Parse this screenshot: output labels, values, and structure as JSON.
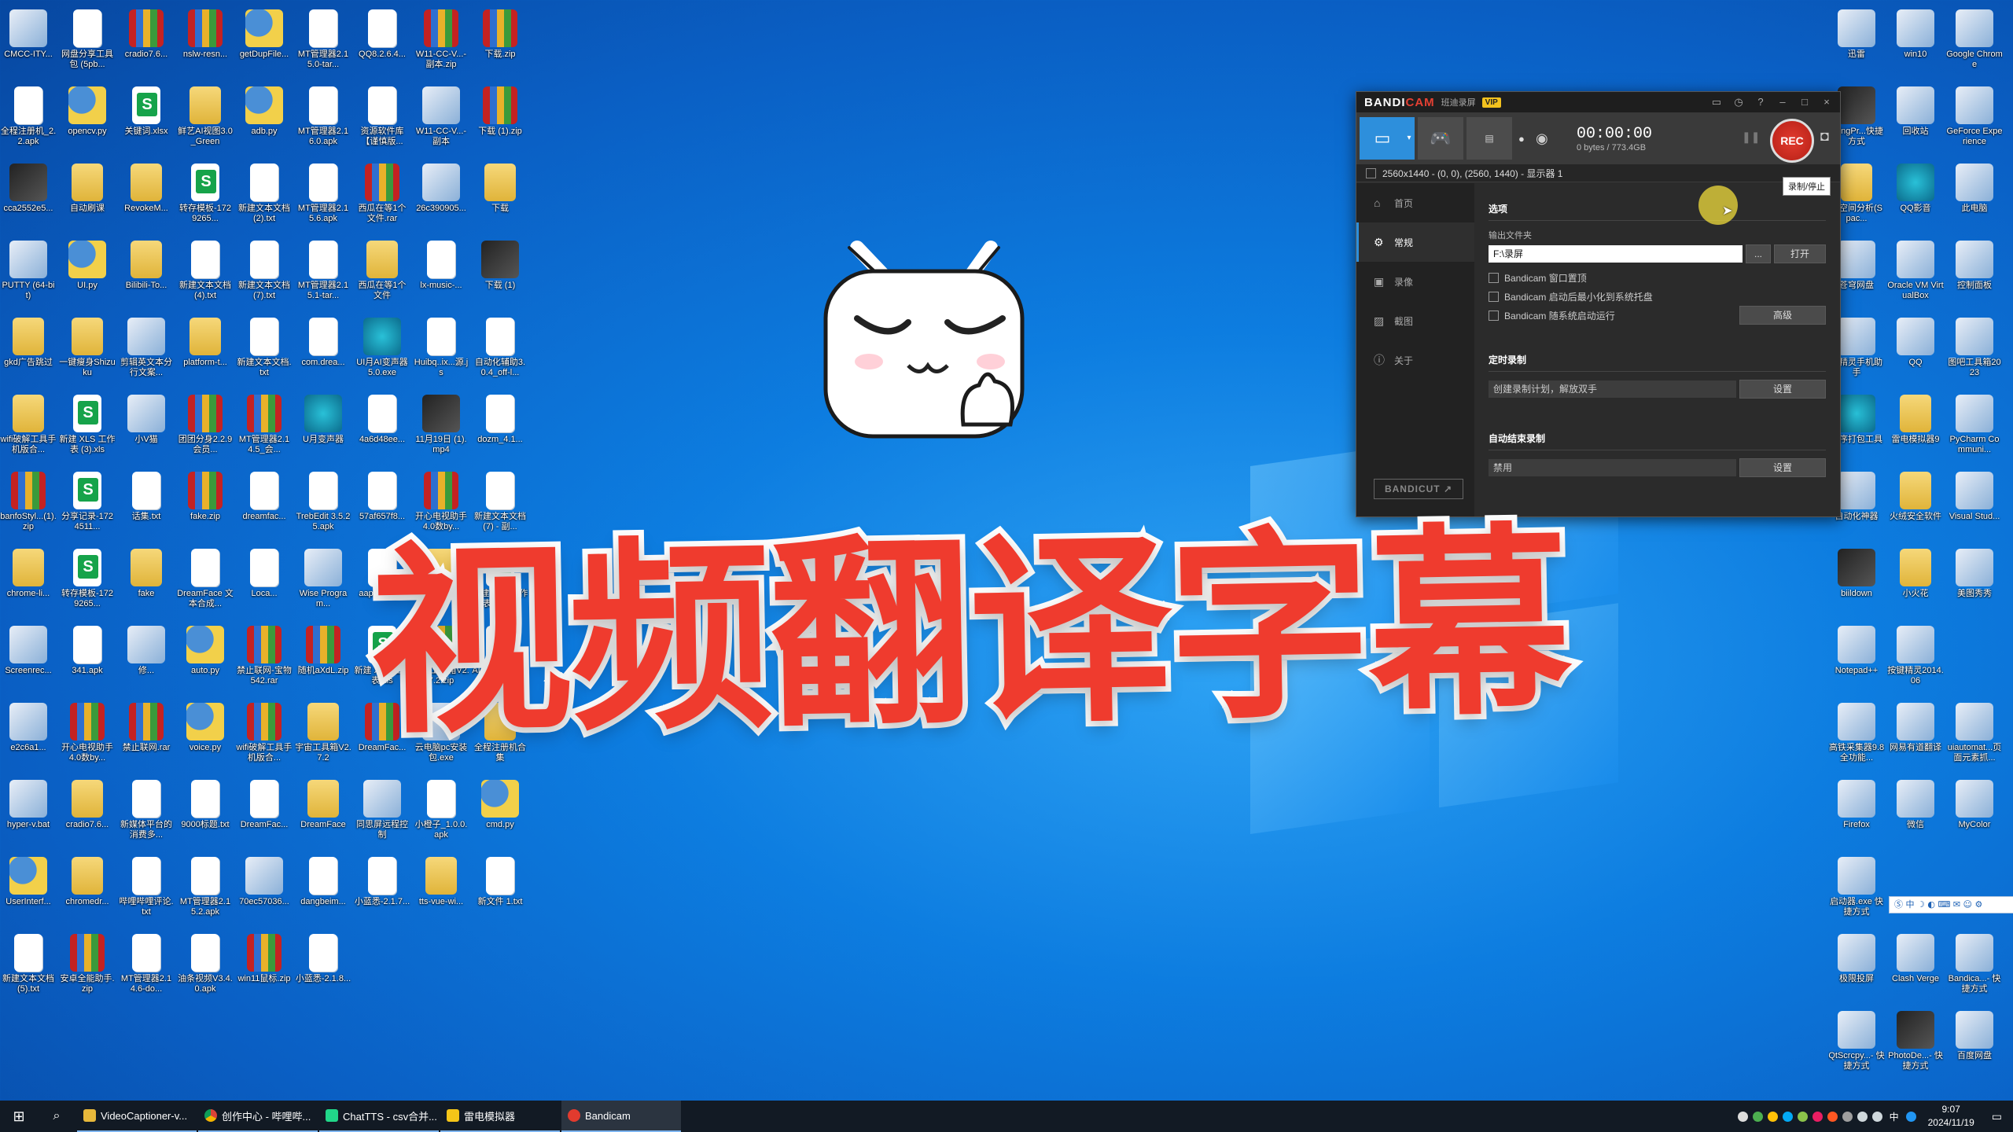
{
  "desktop": {
    "title_overlay": "视频翻译字幕",
    "icons_left": [
      {
        "label": "CMCC-ITY...",
        "type": "app"
      },
      {
        "label": "网盘分享工具包 (5pb...",
        "type": "doc"
      },
      {
        "label": "cradio7.6...",
        "type": "zip"
      },
      {
        "label": "nslw-resn...",
        "type": "zip"
      },
      {
        "label": "getDupFile...",
        "type": "py"
      },
      {
        "label": "MT管理器2.15.0-tar...",
        "type": "doc"
      },
      {
        "label": "QQ8.2.6.4...",
        "type": "doc"
      },
      {
        "label": "W11-CC-V...- 副本.zip",
        "type": "zip"
      },
      {
        "label": "下载.zip",
        "type": "zip"
      },
      {
        "label": "全程注册机_2.2.apk",
        "type": "doc"
      },
      {
        "label": "opencv.py",
        "type": "py"
      },
      {
        "label": "关键词.xlsx",
        "type": "xls"
      },
      {
        "label": "鲜艺AI视图3.0_Green",
        "type": "folder"
      },
      {
        "label": "adb.py",
        "type": "py"
      },
      {
        "label": "MT管理器2.16.0.apk",
        "type": "doc"
      },
      {
        "label": "资源软件库【谨慎版...",
        "type": "doc"
      },
      {
        "label": "W11-CC-V...- 副本",
        "type": "app"
      },
      {
        "label": "下载 (1).zip",
        "type": "zip"
      },
      {
        "label": "cca2552e5...",
        "type": "img"
      },
      {
        "label": "自动刷课",
        "type": "folder"
      },
      {
        "label": "RevokeM...",
        "type": "folder"
      },
      {
        "label": "转存模板-1729265...",
        "type": "xls"
      },
      {
        "label": "新建文本文档 (2).txt",
        "type": "doc"
      },
      {
        "label": "MT管理器2.15.6.apk",
        "type": "doc"
      },
      {
        "label": "西瓜在等1个文件.rar",
        "type": "zip"
      },
      {
        "label": "26c390905...",
        "type": "app"
      },
      {
        "label": "下载",
        "type": "folder"
      },
      {
        "label": "PUTTY (64-bit)",
        "type": "app"
      },
      {
        "label": "UI.py",
        "type": "py"
      },
      {
        "label": "Bilibili-To...",
        "type": "folder"
      },
      {
        "label": "新建文本文档 (4).txt",
        "type": "doc"
      },
      {
        "label": "新建文本文档 (7).txt",
        "type": "doc"
      },
      {
        "label": "MT管理器2.15.1-tar...",
        "type": "doc"
      },
      {
        "label": "西瓜在等1个文件",
        "type": "folder"
      },
      {
        "label": "lx-music-...",
        "type": "doc"
      },
      {
        "label": "下载 (1)",
        "type": "img"
      },
      {
        "label": "gkd广告跳过",
        "type": "folder"
      },
      {
        "label": "一键瘦身Shizuku",
        "type": "folder"
      },
      {
        "label": "剪辑英文本分行文案...",
        "type": "app"
      },
      {
        "label": "platform-t...",
        "type": "folder"
      },
      {
        "label": "新建文本文档.txt",
        "type": "doc"
      },
      {
        "label": "com.drea...",
        "type": "doc"
      },
      {
        "label": "UI月AI变声器5.0.exe",
        "type": "teal"
      },
      {
        "label": "Huibq..ix...源.js",
        "type": "doc"
      },
      {
        "label": "自动化辅助3.0.4_off-l...",
        "type": "doc"
      },
      {
        "label": "wifi破解工具手机版合...",
        "type": "folder"
      },
      {
        "label": "新建 XLS 工作表 (3).xls",
        "type": "xls"
      },
      {
        "label": "小V猫",
        "type": "app"
      },
      {
        "label": "团团分身2.2.9会员...",
        "type": "zip"
      },
      {
        "label": "MT管理器2.14.5_会...",
        "type": "zip"
      },
      {
        "label": "U月变声器",
        "type": "teal"
      },
      {
        "label": "4a6d48ee...",
        "type": "doc"
      },
      {
        "label": "11月19日 (1).mp4",
        "type": "img"
      },
      {
        "label": "dozm_4.1...",
        "type": "doc"
      },
      {
        "label": "banfoStyl...(1).zip",
        "type": "zip"
      },
      {
        "label": "分享记录-1724511...",
        "type": "xls"
      },
      {
        "label": "话集.txt",
        "type": "doc"
      },
      {
        "label": "fake.zip",
        "type": "zip"
      },
      {
        "label": "dreamfac...",
        "type": "doc"
      },
      {
        "label": "TrebEdit 3.5.25.apk",
        "type": "doc"
      },
      {
        "label": "57af657f8...",
        "type": "doc"
      },
      {
        "label": "开心电视助手4.0数by...",
        "type": "zip"
      },
      {
        "label": "新建文本文档 (7) - 副...",
        "type": "doc"
      },
      {
        "label": "chrome-li...",
        "type": "folder"
      },
      {
        "label": "转存模板-1729265...",
        "type": "xls"
      },
      {
        "label": "fake",
        "type": "folder"
      },
      {
        "label": "DreamFace 文本合成...",
        "type": "doc"
      },
      {
        "label": "Loca...",
        "type": "doc"
      },
      {
        "label": "Wise Program...",
        "type": "app"
      },
      {
        "label": "aaptxz_v1...",
        "type": "doc"
      },
      {
        "label": "Bilink-main",
        "type": "folder"
      },
      {
        "label": "新建 XLS 工作表 (2).xls",
        "type": "xls"
      },
      {
        "label": "Screenrec...",
        "type": "app"
      },
      {
        "label": "341.apk",
        "type": "doc"
      },
      {
        "label": "修...",
        "type": "app"
      },
      {
        "label": "auto.py",
        "type": "py"
      },
      {
        "label": "禁止联网-宝物542.rar",
        "type": "zip"
      },
      {
        "label": "随机aXdL.zip",
        "type": "zip"
      },
      {
        "label": "新建 XLS 工作表.xls",
        "type": "xls"
      },
      {
        "label": "宇宙工具箱V2.7.2.zip",
        "type": "zip"
      },
      {
        "label": "AI Video Generator...",
        "type": "doc"
      },
      {
        "label": "e2c6a1...",
        "type": "app"
      },
      {
        "label": "开心电视助手4.0数by...",
        "type": "zip"
      },
      {
        "label": "禁止联网.rar",
        "type": "zip"
      },
      {
        "label": "voice.py",
        "type": "py"
      },
      {
        "label": "wifi破解工具手机版合...",
        "type": "zip"
      },
      {
        "label": "宇宙工具箱V2.7.2",
        "type": "folder"
      },
      {
        "label": "DreamFac...",
        "type": "zip"
      },
      {
        "label": "云电脑pc安装包.exe",
        "type": "app"
      },
      {
        "label": "全程注册机合集",
        "type": "folder"
      },
      {
        "label": "hyper-v.bat",
        "type": "app"
      },
      {
        "label": "cradio7.6...",
        "type": "folder"
      },
      {
        "label": "新媒体平台的消费多...",
        "type": "doc"
      },
      {
        "label": "9000标题.txt",
        "type": "doc"
      },
      {
        "label": "DreamFac...",
        "type": "doc"
      },
      {
        "label": "DreamFace",
        "type": "folder"
      },
      {
        "label": "同思屏远程控制",
        "type": "app"
      },
      {
        "label": "小橙子_1.0.0.apk",
        "type": "doc"
      },
      {
        "label": "cmd.py",
        "type": "py"
      },
      {
        "label": "UserInterf...",
        "type": "py"
      },
      {
        "label": "chromedr...",
        "type": "folder"
      },
      {
        "label": "哔哩哔哩评论.txt",
        "type": "doc"
      },
      {
        "label": "MT管理器2.15.2.apk",
        "type": "doc"
      },
      {
        "label": "70ec57036...",
        "type": "app"
      },
      {
        "label": "dangbeim...",
        "type": "doc"
      },
      {
        "label": "小蓝悉-2.1.7...",
        "type": "doc"
      },
      {
        "label": "tts-vue-wi...",
        "type": "folder"
      },
      {
        "label": "新文件 1.txt",
        "type": "doc"
      },
      {
        "label": "新建文本文档 (5).txt",
        "type": "doc"
      },
      {
        "label": "安卓全能助手.zip",
        "type": "zip"
      },
      {
        "label": "MT管理器2.14.6-do...",
        "type": "doc"
      },
      {
        "label": "油条视频V3.4.0.apk",
        "type": "doc"
      },
      {
        "label": "win11鼠标.zip",
        "type": "zip"
      },
      {
        "label": "小蓝悉-2.1.8...",
        "type": "doc"
      }
    ],
    "icons_right": [
      {
        "label": "迅雷",
        "type": "app"
      },
      {
        "label": "win10",
        "type": "app"
      },
      {
        "label": "Google Chrome",
        "type": "app"
      },
      {
        "label": "nyingPr...快捷方式",
        "type": "img"
      },
      {
        "label": "回收站",
        "type": "app"
      },
      {
        "label": "GeForce Experience",
        "type": "app"
      },
      {
        "label": "盘空间分析(Spac...",
        "type": "folder"
      },
      {
        "label": "QQ影音",
        "type": "teal"
      },
      {
        "label": "此电脑",
        "type": "app"
      },
      {
        "label": "苍穹网盘",
        "type": "app"
      },
      {
        "label": "Oracle VM VirtualBox",
        "type": "app"
      },
      {
        "label": "控制面板",
        "type": "app"
      },
      {
        "label": "键精灵手机助手",
        "type": "app"
      },
      {
        "label": "QQ",
        "type": "app"
      },
      {
        "label": "图吧工具箱2023",
        "type": "app"
      },
      {
        "label": "程序打包工具",
        "type": "teal"
      },
      {
        "label": "雷电模拟器9",
        "type": "folder"
      },
      {
        "label": "PyCharm Communi...",
        "type": "app"
      },
      {
        "label": "自动化神器",
        "type": "app"
      },
      {
        "label": "火绒安全软件",
        "type": "folder"
      },
      {
        "label": "Visual Stud...",
        "type": "app"
      },
      {
        "label": "biildown",
        "type": "img"
      },
      {
        "label": "小火花",
        "type": "folder"
      },
      {
        "label": "美图秀秀",
        "type": "app"
      },
      {
        "label": "Notepad++",
        "type": "app"
      },
      {
        "label": "按键精灵2014.06",
        "type": "app"
      },
      {
        "label": "",
        "type": "none"
      },
      {
        "label": "高铁采集器9.8全功能...",
        "type": "app"
      },
      {
        "label": "网易有道翻译",
        "type": "app"
      },
      {
        "label": "uiautomat...页面元素抓...",
        "type": "app"
      },
      {
        "label": "Firefox",
        "type": "app"
      },
      {
        "label": "微信",
        "type": "app"
      },
      {
        "label": "MyColor",
        "type": "app"
      },
      {
        "label": "启动器.exe 快捷方式",
        "type": "app"
      },
      {
        "label": "",
        "type": "none"
      },
      {
        "label": "",
        "type": "none"
      },
      {
        "label": "极限投屏",
        "type": "app"
      },
      {
        "label": "Clash Verge",
        "type": "app"
      },
      {
        "label": "Bandica...- 快捷方式",
        "type": "app"
      },
      {
        "label": "QtScrcpy...- 快捷方式",
        "type": "app"
      },
      {
        "label": "PhotoDe...- 快捷方式",
        "type": "img"
      },
      {
        "label": "百度网盘",
        "type": "app"
      }
    ]
  },
  "bandicam": {
    "logo_a": "BANDI",
    "logo_b": "CAM",
    "subtitle": "班迪录屏",
    "vip": "VIP",
    "timer": "00:00:00",
    "filesize": "0 bytes / 773.4GB",
    "rec_label": "REC",
    "rec_tooltip": "录制/停止",
    "area_info": "2560x1440 - (0, 0), (2560, 1440) - 显示器 1",
    "nav": [
      "首页",
      "常规",
      "录像",
      "截图",
      "关于"
    ],
    "bandicut": "BANDICUT ↗",
    "options_header": "选项",
    "output_folder_label": "输出文件夹",
    "output_folder_value": "F:\\录屏",
    "browse_btn": "...",
    "open_btn": "打开",
    "checkboxes": [
      "Bandicam 窗口置顶",
      "Bandicam 启动后最小化到系统托盘",
      "Bandicam 随系统启动运行"
    ],
    "advanced_btn": "高级",
    "timer_header": "定时录制",
    "timer_field": "创建录制计划，解放双手",
    "settings_btn": "设置",
    "autostop_header": "自动结束录制",
    "autostop_field": "禁用",
    "settings_btn2": "设置"
  },
  "taskbar": {
    "tasks": [
      "VideoCaptioner-v...",
      "创作中心 - 哔哩哔...",
      "ChatTTS - csv合并...",
      "雷电模拟器",
      "Bandicam"
    ],
    "time": "9:07",
    "date": "2024/11/19",
    "ime_lang": "中"
  }
}
